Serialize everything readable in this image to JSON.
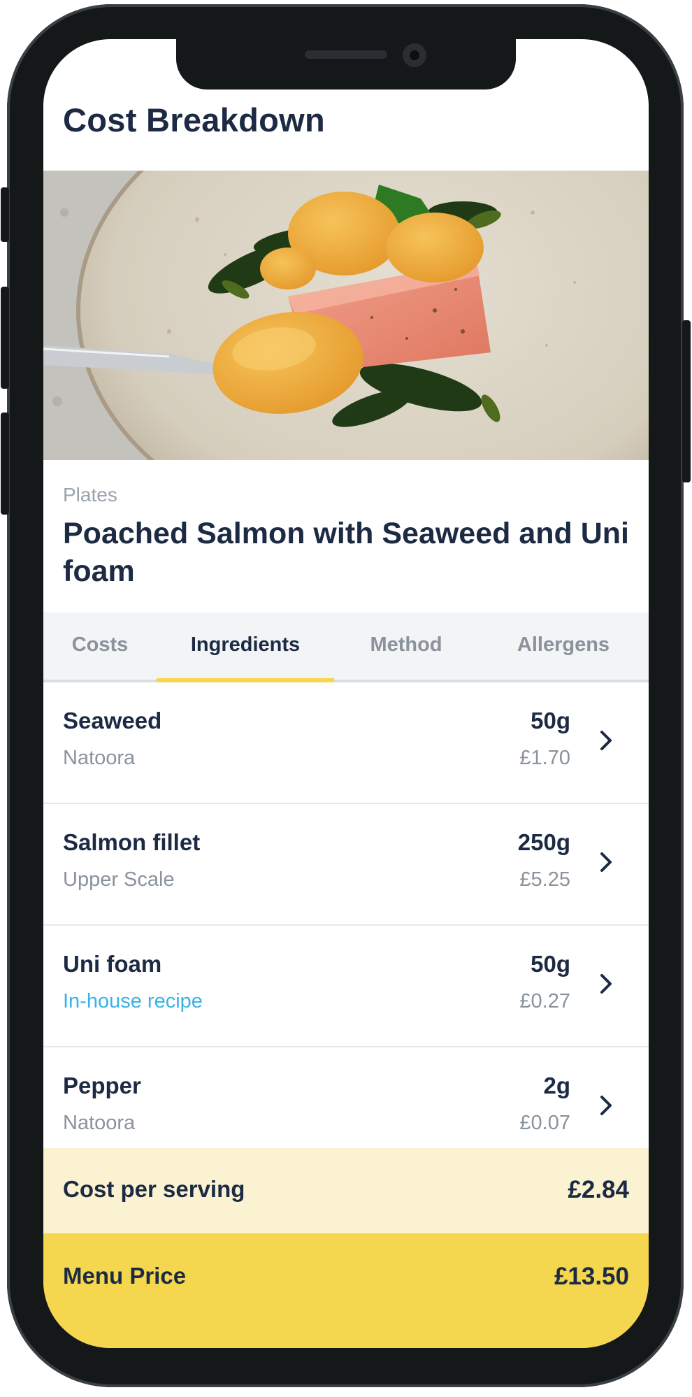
{
  "header": {
    "title": "Cost Breakdown"
  },
  "hero": {
    "image": "poached-salmon-photo"
  },
  "dish": {
    "category": "Plates",
    "name": "Poached Salmon with Seaweed and Uni foam"
  },
  "tabs": [
    {
      "label": "Costs",
      "active": false
    },
    {
      "label": "Ingredients",
      "active": true
    },
    {
      "label": "Method",
      "active": false
    },
    {
      "label": "Allergens",
      "active": false
    }
  ],
  "ingredients": [
    {
      "name": "Seaweed",
      "supplier": "Natoora",
      "quantity": "50g",
      "cost": "£1.70",
      "supplier_is_link": false
    },
    {
      "name": "Salmon fillet",
      "supplier": "Upper Scale",
      "quantity": "250g",
      "cost": "£5.25",
      "supplier_is_link": false
    },
    {
      "name": "Uni foam",
      "supplier": "In-house recipe",
      "quantity": "50g",
      "cost": "£0.27",
      "supplier_is_link": true
    },
    {
      "name": "Pepper",
      "supplier": "Natoora",
      "quantity": "2g",
      "cost": "£0.07",
      "supplier_is_link": false
    }
  ],
  "summary": {
    "cost_per_serving_label": "Cost per serving",
    "cost_per_serving_value": "£2.84",
    "menu_price_label": "Menu Price",
    "menu_price_value": "£13.50"
  },
  "colors": {
    "accent": "#f5d64f",
    "text_primary": "#1c2a44",
    "text_secondary": "#8a929c",
    "link": "#39b3e4",
    "summary_bg": "#faf2d0"
  }
}
